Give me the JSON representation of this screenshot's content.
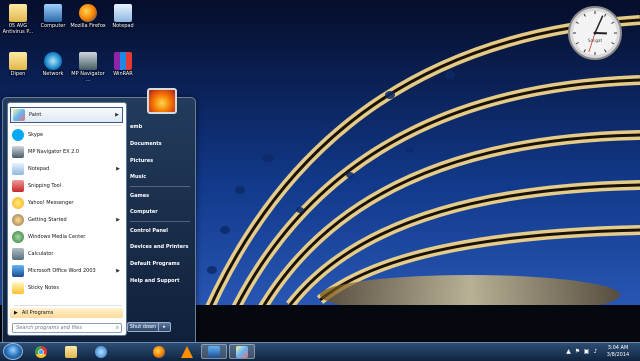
{
  "desktop": {
    "icons": [
      {
        "label": "05 AVG Antivirus P...",
        "icon": "folder-icon"
      },
      {
        "label": "Computer",
        "icon": "computer-icon"
      },
      {
        "label": "Mozilla Firefox",
        "icon": "firefox-icon"
      },
      {
        "label": "Notepad",
        "icon": "notepad-icon"
      },
      {
        "label": "Dipen",
        "icon": "folder-icon"
      },
      {
        "label": "Network",
        "icon": "network-icon"
      },
      {
        "label": "MP Navigator ...",
        "icon": "mp-navigator-icon"
      },
      {
        "label": "WinRAR",
        "icon": "winrar-icon"
      }
    ],
    "clock_gadget": {
      "brand": "Sangat",
      "time": "3:04",
      "hour": 3,
      "minute": 4,
      "second": 33
    }
  },
  "start_menu": {
    "pinned": {
      "label": "Paint",
      "icon": "paint-icon"
    },
    "programs": [
      {
        "label": "Skype",
        "icon": "skype-icon",
        "has_submenu": false
      },
      {
        "label": "MP Navigator EX 2.0",
        "icon": "mp-navigator-icon",
        "has_submenu": false
      },
      {
        "label": "Notepad",
        "icon": "notepad-icon",
        "has_submenu": true
      },
      {
        "label": "Snipping Tool",
        "icon": "scissors-icon",
        "has_submenu": false
      },
      {
        "label": "Yahoo! Messenger",
        "icon": "yahoo-messenger-icon",
        "has_submenu": false
      },
      {
        "label": "Getting Started",
        "icon": "getting-started-icon",
        "has_submenu": true
      },
      {
        "label": "Windows Media Center",
        "icon": "media-center-icon",
        "has_submenu": false
      },
      {
        "label": "Calculator",
        "icon": "calculator-icon",
        "has_submenu": false
      },
      {
        "label": "Microsoft Office Word 2003",
        "icon": "word-icon",
        "has_submenu": true
      },
      {
        "label": "Sticky Notes",
        "icon": "sticky-notes-icon",
        "has_submenu": false
      }
    ],
    "all_programs": "All Programs",
    "search_placeholder": "Search programs and files",
    "right_items": [
      "emb",
      "Documents",
      "Pictures",
      "Music",
      "Games",
      "Computer",
      "Control Panel",
      "Devices and Printers",
      "Default Programs",
      "Help and Support"
    ],
    "shutdown_label": "Shut down",
    "shutdown_arrow": "▸"
  },
  "taskbar": {
    "buttons": [
      {
        "name": "chrome-icon",
        "color": "#e53935"
      },
      {
        "name": "explorer-folder-icon",
        "color": "#f2c14e"
      },
      {
        "name": "internet-explorer-icon",
        "color": "#2f86d6"
      },
      {
        "name": "firefox-icon",
        "color": "#f57c00"
      },
      {
        "name": "vlc-icon",
        "color": "#ff8f00"
      },
      {
        "name": "word-icon",
        "color": "#2b579a"
      },
      {
        "name": "paint-icon",
        "color": "#90caf9"
      }
    ],
    "time": "3:04 AM",
    "date": "3/8/2014"
  }
}
